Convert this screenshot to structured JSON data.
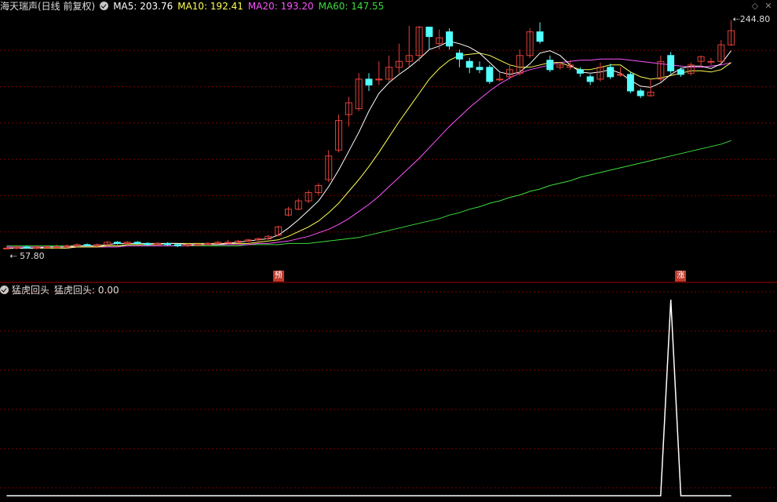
{
  "header": {
    "title": "海天瑞声(日线 前复权)",
    "ma5": "MA5: 203.76",
    "ma10": "MA10: 192.41",
    "ma20": "MA20: 193.20",
    "ma60": "MA60: 147.55"
  },
  "indicator": {
    "name": "猛虎回头",
    "value": "猛虎回头: 0.00"
  },
  "markers": {
    "high": "244.80",
    "low": "57.80",
    "signal_yu": "预",
    "signal_zhang": "涨"
  },
  "colors": {
    "up": "#e0403a",
    "down": "#54ffff",
    "ma5": "#ffffff",
    "ma10": "#ffff54",
    "ma20": "#ff54ff",
    "ma60": "#3ddc3d",
    "grid": "#7a0000",
    "indicator": "#ffffff"
  },
  "chart_data": [
    {
      "type": "candlestick",
      "title": "海天瑞声(日线 前复权)",
      "ylim": [
        40,
        255
      ],
      "candles": [
        [
          57,
          57,
          58,
          56
        ],
        [
          57,
          58,
          59,
          56
        ],
        [
          58,
          57,
          59,
          57
        ],
        [
          57,
          58,
          59,
          56
        ],
        [
          58,
          58,
          59,
          57
        ],
        [
          58,
          58,
          60,
          57
        ],
        [
          58,
          59,
          60,
          57
        ],
        [
          59,
          60,
          61,
          58
        ],
        [
          60,
          59,
          61,
          59
        ],
        [
          59,
          60,
          61,
          58
        ],
        [
          60,
          62,
          63,
          59
        ],
        [
          62,
          61,
          63,
          60
        ],
        [
          61,
          62,
          63,
          60
        ],
        [
          62,
          61,
          63,
          60
        ],
        [
          61,
          60,
          62,
          59
        ],
        [
          60,
          61,
          62,
          59
        ],
        [
          61,
          60,
          62,
          59
        ],
        [
          60,
          59,
          61,
          58
        ],
        [
          59,
          60,
          61,
          58
        ],
        [
          60,
          60,
          61,
          59
        ],
        [
          60,
          61,
          62,
          59
        ],
        [
          61,
          62,
          63,
          60
        ],
        [
          62,
          62,
          64,
          61
        ],
        [
          62,
          63,
          64,
          61
        ],
        [
          63,
          64,
          65,
          62
        ],
        [
          64,
          65,
          66,
          63
        ],
        [
          65,
          67,
          68,
          64
        ],
        [
          68,
          75,
          76,
          67
        ],
        [
          85,
          90,
          92,
          84
        ],
        [
          90,
          97,
          99,
          89
        ],
        [
          97,
          104,
          106,
          95
        ],
        [
          104,
          110,
          112,
          102
        ],
        [
          115,
          135,
          140,
          113
        ],
        [
          140,
          165,
          170,
          138
        ],
        [
          170,
          180,
          185,
          160
        ],
        [
          175,
          200,
          205,
          173
        ],
        [
          200,
          195,
          205,
          190
        ],
        [
          200,
          200,
          215,
          195
        ],
        [
          200,
          210,
          220,
          198
        ],
        [
          210,
          215,
          230,
          205
        ],
        [
          215,
          220,
          245,
          210
        ],
        [
          220,
          244,
          245,
          215
        ],
        [
          244,
          236,
          244,
          225
        ],
        [
          230,
          235,
          242,
          225
        ],
        [
          240,
          228,
          243,
          225
        ],
        [
          222,
          217,
          225,
          210
        ],
        [
          215,
          210,
          218,
          205
        ],
        [
          210,
          208,
          215,
          205
        ],
        [
          210,
          198,
          212,
          196
        ],
        [
          200,
          200,
          206,
          198
        ],
        [
          202,
          208,
          212,
          200
        ],
        [
          205,
          220,
          225,
          203
        ],
        [
          220,
          240,
          243,
          218
        ],
        [
          240,
          232,
          248,
          230
        ],
        [
          216,
          208,
          220,
          206
        ],
        [
          210,
          212,
          214,
          208
        ],
        [
          210,
          212,
          216,
          208
        ],
        [
          208,
          205,
          210,
          202
        ],
        [
          202,
          198,
          204,
          195
        ],
        [
          200,
          210,
          214,
          198
        ],
        [
          210,
          202,
          213,
          200
        ],
        [
          204,
          204,
          210,
          202
        ],
        [
          204,
          190,
          206,
          188
        ],
        [
          190,
          186,
          192,
          184
        ],
        [
          186,
          189,
          200,
          185
        ],
        [
          200,
          215,
          220,
          198
        ],
        [
          220,
          207,
          223,
          205
        ],
        [
          208,
          204,
          210,
          202
        ],
        [
          205,
          212,
          214,
          203
        ],
        [
          215,
          219,
          220,
          210
        ],
        [
          215,
          215,
          218,
          212
        ],
        [
          215,
          229,
          233,
          213
        ],
        [
          229,
          241,
          250,
          228
        ]
      ],
      "ma5": [
        57,
        57,
        57,
        57,
        58,
        58,
        58,
        59,
        59,
        59,
        60,
        61,
        61,
        61,
        61,
        61,
        61,
        61,
        60,
        60,
        60,
        60,
        61,
        62,
        63,
        64,
        65,
        68,
        74,
        81,
        89,
        97,
        109,
        123,
        139,
        155,
        173,
        188,
        197,
        204,
        210,
        217,
        225,
        228,
        232,
        230,
        227,
        222,
        214,
        206,
        204,
        206,
        213,
        222,
        224,
        220,
        212,
        206,
        205,
        206,
        208,
        205,
        199,
        194,
        193,
        197,
        204,
        209,
        211,
        211,
        209,
        213,
        224
      ],
      "ma10": [
        57,
        57,
        57,
        57,
        57,
        57,
        57,
        58,
        58,
        58,
        59,
        59,
        60,
        60,
        60,
        60,
        61,
        61,
        61,
        61,
        61,
        61,
        61,
        61,
        61,
        62,
        63,
        64,
        67,
        71,
        75,
        80,
        87,
        95,
        105,
        115,
        126,
        138,
        151,
        164,
        176,
        188,
        200,
        209,
        216,
        220,
        221,
        222,
        220,
        216,
        212,
        210,
        210,
        212,
        214,
        214,
        211,
        208,
        208,
        210,
        212,
        212,
        206,
        202,
        200,
        201,
        203,
        205,
        207,
        207,
        206,
        208,
        214
      ],
      "ma20": [
        58,
        58,
        58,
        58,
        58,
        58,
        58,
        58,
        58,
        58,
        58,
        58,
        59,
        59,
        59,
        59,
        59,
        59,
        59,
        60,
        60,
        60,
        60,
        60,
        60,
        61,
        61,
        62,
        63,
        65,
        67,
        70,
        73,
        77,
        82,
        88,
        94,
        101,
        109,
        117,
        125,
        133,
        142,
        151,
        160,
        168,
        176,
        183,
        190,
        196,
        201,
        205,
        208,
        210,
        212,
        214,
        215,
        216,
        216,
        217,
        217,
        217,
        216,
        215,
        214,
        213,
        212,
        211,
        210,
        210,
        211,
        212,
        214
      ],
      "ma60": [
        59,
        59,
        59,
        59,
        59,
        59,
        59,
        59,
        59,
        59,
        59,
        59,
        59,
        59,
        59,
        59,
        59,
        59,
        59,
        59,
        59,
        59,
        59,
        59,
        60,
        60,
        60,
        60,
        61,
        61,
        61,
        62,
        63,
        64,
        65,
        66,
        68,
        70,
        72,
        74,
        76,
        78,
        80,
        82,
        85,
        87,
        90,
        92,
        95,
        97,
        100,
        102,
        105,
        107,
        110,
        112,
        114,
        117,
        119,
        121,
        123,
        125,
        127,
        129,
        131,
        133,
        135,
        137,
        139,
        141,
        143,
        145,
        148
      ]
    },
    {
      "type": "line",
      "title": "猛虎回头",
      "ylim": [
        0,
        1
      ],
      "values": [
        0,
        0,
        0,
        0,
        0,
        0,
        0,
        0,
        0,
        0,
        0,
        0,
        0,
        0,
        0,
        0,
        0,
        0,
        0,
        0,
        0,
        0,
        0,
        0,
        0,
        0,
        0,
        0,
        0,
        0,
        0,
        0,
        0,
        0,
        0,
        0,
        0,
        0,
        0,
        0,
        0,
        0,
        0,
        0,
        0,
        0,
        0,
        0,
        0,
        0,
        0,
        0,
        0,
        0,
        0,
        0,
        0,
        0,
        0,
        0,
        0,
        0,
        0,
        0,
        0,
        0,
        1,
        0,
        0,
        0,
        0,
        0,
        0
      ]
    }
  ]
}
